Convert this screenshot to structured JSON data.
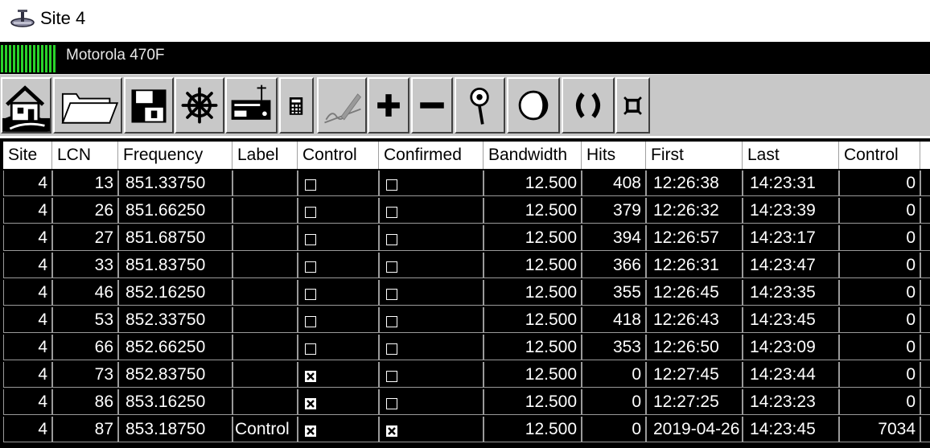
{
  "window": {
    "title": "Site 4",
    "icon": "radio-tower-icon"
  },
  "status": {
    "system_name": "Motorola 470F",
    "signal_color": "#2ad22a"
  },
  "toolbar": {
    "buttons": [
      {
        "name": "home-icon"
      },
      {
        "name": "open-folder-icon"
      },
      {
        "name": "save-icon"
      },
      {
        "name": "wheel-icon"
      },
      {
        "name": "receiver-icon"
      },
      {
        "name": "calculator-icon"
      },
      {
        "name": "signature-icon"
      },
      {
        "name": "plus-icon"
      },
      {
        "name": "minus-icon"
      },
      {
        "name": "magnifier-icon"
      },
      {
        "name": "circle-icon"
      },
      {
        "name": "brackets-icon"
      },
      {
        "name": "scatter-icon"
      }
    ]
  },
  "table": {
    "columns": [
      "Site",
      "LCN",
      "Frequency",
      "Label",
      "Control",
      "Confirmed",
      "Bandwidth",
      "Hits",
      "First",
      "Last",
      "Control"
    ],
    "rows": [
      {
        "site": "4",
        "lcn": "13",
        "frequency": "851.33750",
        "label": "",
        "control": false,
        "confirmed": false,
        "bandwidth": "12.500",
        "hits": "408",
        "first": "12:26:38",
        "last": "14:23:31",
        "control_count": "0"
      },
      {
        "site": "4",
        "lcn": "26",
        "frequency": "851.66250",
        "label": "",
        "control": false,
        "confirmed": false,
        "bandwidth": "12.500",
        "hits": "379",
        "first": "12:26:32",
        "last": "14:23:39",
        "control_count": "0"
      },
      {
        "site": "4",
        "lcn": "27",
        "frequency": "851.68750",
        "label": "",
        "control": false,
        "confirmed": false,
        "bandwidth": "12.500",
        "hits": "394",
        "first": "12:26:57",
        "last": "14:23:17",
        "control_count": "0"
      },
      {
        "site": "4",
        "lcn": "33",
        "frequency": "851.83750",
        "label": "",
        "control": false,
        "confirmed": false,
        "bandwidth": "12.500",
        "hits": "366",
        "first": "12:26:31",
        "last": "14:23:47",
        "control_count": "0"
      },
      {
        "site": "4",
        "lcn": "46",
        "frequency": "852.16250",
        "label": "",
        "control": false,
        "confirmed": false,
        "bandwidth": "12.500",
        "hits": "355",
        "first": "12:26:45",
        "last": "14:23:35",
        "control_count": "0"
      },
      {
        "site": "4",
        "lcn": "53",
        "frequency": "852.33750",
        "label": "",
        "control": false,
        "confirmed": false,
        "bandwidth": "12.500",
        "hits": "418",
        "first": "12:26:43",
        "last": "14:23:45",
        "control_count": "0"
      },
      {
        "site": "4",
        "lcn": "66",
        "frequency": "852.66250",
        "label": "",
        "control": false,
        "confirmed": false,
        "bandwidth": "12.500",
        "hits": "353",
        "first": "12:26:50",
        "last": "14:23:09",
        "control_count": "0"
      },
      {
        "site": "4",
        "lcn": "73",
        "frequency": "852.83750",
        "label": "",
        "control": true,
        "confirmed": false,
        "bandwidth": "12.500",
        "hits": "0",
        "first": "12:27:45",
        "last": "14:23:44",
        "control_count": "0"
      },
      {
        "site": "4",
        "lcn": "86",
        "frequency": "853.16250",
        "label": "",
        "control": true,
        "confirmed": false,
        "bandwidth": "12.500",
        "hits": "0",
        "first": "12:27:25",
        "last": "14:23:23",
        "control_count": "0"
      },
      {
        "site": "4",
        "lcn": "87",
        "frequency": "853.18750",
        "label": "Control",
        "control": true,
        "confirmed": true,
        "bandwidth": "12.500",
        "hits": "0",
        "first": "2019-04-26",
        "last": "14:23:45",
        "control_count": "7034"
      }
    ]
  }
}
